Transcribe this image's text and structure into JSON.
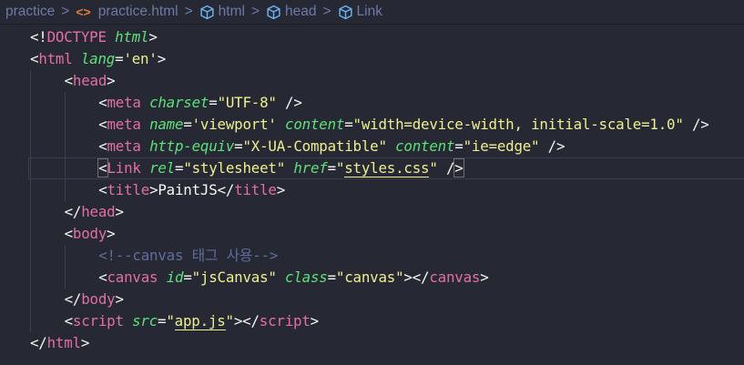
{
  "breadcrumb": [
    {
      "label": "practice",
      "icon": null
    },
    {
      "label": "practice.html",
      "icon": "html-file-icon"
    },
    {
      "label": "html",
      "icon": "cube-icon"
    },
    {
      "label": "head",
      "icon": "cube-icon"
    },
    {
      "label": "Link",
      "icon": "cube-icon"
    }
  ],
  "colors": {
    "background": "#262833",
    "tag": "#e36fa5",
    "attribute": "#5ee07a",
    "string": "#efef90",
    "comment": "#5f6d9c"
  },
  "lines": [
    {
      "indent": 0,
      "tokens": [
        [
          "<!",
          "punct"
        ],
        [
          "DOCTYPE",
          "kw"
        ],
        [
          " ",
          "text"
        ],
        [
          "html",
          "attr"
        ],
        [
          ">",
          "punct"
        ]
      ]
    },
    {
      "indent": 0,
      "tokens": [
        [
          "<",
          "punct"
        ],
        [
          "html",
          "tag"
        ],
        [
          " ",
          "text"
        ],
        [
          "lang",
          "attr"
        ],
        [
          "=",
          "punct"
        ],
        [
          "'en'",
          "str"
        ],
        [
          ">",
          "punct"
        ]
      ]
    },
    {
      "indent": 1,
      "tokens": [
        [
          "<",
          "punct"
        ],
        [
          "head",
          "tag"
        ],
        [
          ">",
          "punct"
        ]
      ]
    },
    {
      "indent": 2,
      "tokens": [
        [
          "<",
          "punct"
        ],
        [
          "meta",
          "tag"
        ],
        [
          " ",
          "text"
        ],
        [
          "charset",
          "attr"
        ],
        [
          "=",
          "punct"
        ],
        [
          "\"UTF-8\"",
          "str"
        ],
        [
          " />",
          "punct"
        ]
      ]
    },
    {
      "indent": 2,
      "tokens": [
        [
          "<",
          "punct"
        ],
        [
          "meta",
          "tag"
        ],
        [
          " ",
          "text"
        ],
        [
          "name",
          "attr"
        ],
        [
          "=",
          "punct"
        ],
        [
          "'viewport'",
          "str"
        ],
        [
          " ",
          "text"
        ],
        [
          "content",
          "attr"
        ],
        [
          "=",
          "punct"
        ],
        [
          "\"width=device-width, initial-scale=1.0\"",
          "str"
        ],
        [
          " />",
          "punct"
        ]
      ]
    },
    {
      "indent": 2,
      "tokens": [
        [
          "<",
          "punct"
        ],
        [
          "meta",
          "tag"
        ],
        [
          " ",
          "text"
        ],
        [
          "http-equiv",
          "attr"
        ],
        [
          "=",
          "punct"
        ],
        [
          "\"X-UA-Compatible\"",
          "str"
        ],
        [
          " ",
          "text"
        ],
        [
          "content",
          "attr"
        ],
        [
          "=",
          "punct"
        ],
        [
          "\"ie=edge\"",
          "str"
        ],
        [
          " />",
          "punct"
        ]
      ]
    },
    {
      "indent": 2,
      "active": true,
      "tokens": [
        [
          "<",
          "punct",
          "bracket"
        ],
        [
          "Link",
          "tag"
        ],
        [
          " ",
          "text"
        ],
        [
          "rel",
          "attr"
        ],
        [
          "=",
          "punct"
        ],
        [
          "\"stylesheet\"",
          "str"
        ],
        [
          " ",
          "text"
        ],
        [
          "href",
          "attr"
        ],
        [
          "=",
          "punct"
        ],
        [
          "\"",
          "str"
        ],
        [
          "styles.css",
          "str",
          "u"
        ],
        [
          "\"",
          "str"
        ],
        [
          " /",
          "punct"
        ],
        [
          ">",
          "punct",
          "bracket"
        ]
      ]
    },
    {
      "indent": 2,
      "tokens": [
        [
          "<",
          "punct"
        ],
        [
          "title",
          "tag"
        ],
        [
          ">",
          "punct"
        ],
        [
          "PaintJS",
          "text"
        ],
        [
          "</",
          "punct"
        ],
        [
          "title",
          "tag"
        ],
        [
          ">",
          "punct"
        ]
      ]
    },
    {
      "indent": 1,
      "tokens": [
        [
          "</",
          "punct"
        ],
        [
          "head",
          "tag"
        ],
        [
          ">",
          "punct"
        ]
      ]
    },
    {
      "indent": 1,
      "tokens": [
        [
          "<",
          "punct"
        ],
        [
          "body",
          "tag"
        ],
        [
          ">",
          "punct"
        ]
      ]
    },
    {
      "indent": 2,
      "tokens": [
        [
          "<!--canvas 태그 사용-->",
          "comment"
        ]
      ]
    },
    {
      "indent": 2,
      "tokens": [
        [
          "<",
          "punct"
        ],
        [
          "canvas",
          "tag"
        ],
        [
          " ",
          "text"
        ],
        [
          "id",
          "attr"
        ],
        [
          "=",
          "punct"
        ],
        [
          "\"jsCanvas\"",
          "str"
        ],
        [
          " ",
          "text"
        ],
        [
          "class",
          "attr"
        ],
        [
          "=",
          "punct"
        ],
        [
          "\"canvas\"",
          "str"
        ],
        [
          "></",
          "punct"
        ],
        [
          "canvas",
          "tag"
        ],
        [
          ">",
          "punct"
        ]
      ]
    },
    {
      "indent": 1,
      "tokens": [
        [
          "</",
          "punct"
        ],
        [
          "body",
          "tag"
        ],
        [
          ">",
          "punct"
        ]
      ]
    },
    {
      "indent": 1,
      "tokens": [
        [
          "<",
          "punct"
        ],
        [
          "script",
          "tag"
        ],
        [
          " ",
          "text"
        ],
        [
          "src",
          "attr"
        ],
        [
          "=",
          "punct"
        ],
        [
          "\"",
          "str"
        ],
        [
          "app.js",
          "str",
          "u"
        ],
        [
          "\"",
          "str"
        ],
        [
          "></",
          "punct"
        ],
        [
          "script",
          "tag"
        ],
        [
          ">",
          "punct"
        ]
      ]
    },
    {
      "indent": 0,
      "tokens": [
        [
          "</",
          "punct"
        ],
        [
          "html",
          "tag"
        ],
        [
          ">",
          "punct"
        ]
      ]
    }
  ]
}
